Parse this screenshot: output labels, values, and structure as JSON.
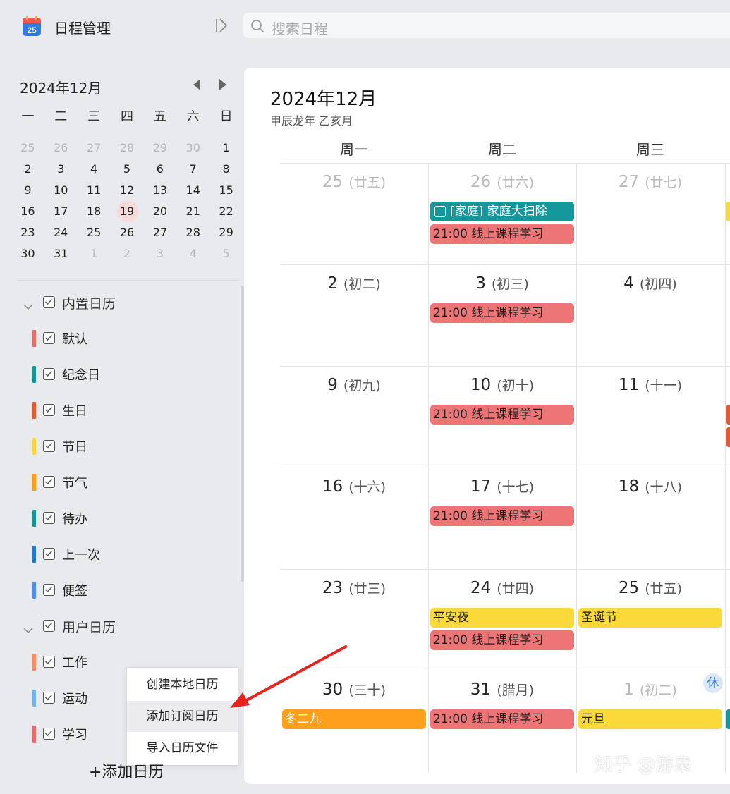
{
  "app": {
    "title": "日程管理",
    "icon_day": "25",
    "icon": "calendar-app-icon"
  },
  "search": {
    "placeholder": "搜索日程"
  },
  "mini_calendar": {
    "month_label": "2024年12月",
    "weekdays": [
      "一",
      "二",
      "三",
      "四",
      "五",
      "六",
      "日"
    ],
    "weeks": [
      [
        "25",
        "26",
        "27",
        "28",
        "29",
        "30",
        "1"
      ],
      [
        "2",
        "3",
        "4",
        "5",
        "6",
        "7",
        "8"
      ],
      [
        "9",
        "10",
        "11",
        "12",
        "13",
        "14",
        "15"
      ],
      [
        "16",
        "17",
        "18",
        "19",
        "20",
        "21",
        "22"
      ],
      [
        "23",
        "24",
        "25",
        "26",
        "27",
        "28",
        "29"
      ],
      [
        "30",
        "31",
        "1",
        "2",
        "3",
        "4",
        "5"
      ]
    ],
    "today": "19"
  },
  "calendar_groups": [
    {
      "label": "内置日历",
      "checked": true,
      "items": [
        {
          "label": "默认",
          "color": "#e76f6c",
          "checked": true
        },
        {
          "label": "纪念日",
          "color": "#13989d",
          "checked": true
        },
        {
          "label": "生日",
          "color": "#e6592c",
          "checked": true
        },
        {
          "label": "节日",
          "color": "#fcd53a",
          "checked": true
        },
        {
          "label": "节气",
          "color": "#fd9d12",
          "checked": true
        },
        {
          "label": "待办",
          "color": "#14979b",
          "checked": true
        },
        {
          "label": "上一次",
          "color": "#2378cf",
          "checked": true
        },
        {
          "label": "便签",
          "color": "#4d8ef0",
          "checked": true
        }
      ]
    },
    {
      "label": "用户日历",
      "checked": true,
      "items": [
        {
          "label": "工作",
          "color": "#f58e64",
          "checked": true
        },
        {
          "label": "运动",
          "color": "#72b3ef",
          "checked": true
        },
        {
          "label": "学习",
          "color": "#e66b6b",
          "checked": true
        }
      ]
    }
  ],
  "menu": {
    "items": [
      "创建本地日历",
      "添加订阅日历",
      "导入日历文件"
    ],
    "highlighted": "添加订阅日历"
  },
  "add_calendar_label": "+添加日历",
  "main": {
    "month_title": "2024年12月",
    "ganzhi": "甲辰龙年 乙亥月",
    "weekday_headers": [
      "周一",
      "周二",
      "周三"
    ],
    "weeks": [
      [
        {
          "day": "25",
          "lunar": "廿五",
          "muted": true,
          "events": []
        },
        {
          "day": "26",
          "lunar": "廿六",
          "muted": true,
          "events": [
            {
              "text": "[家庭] 家庭大扫除",
              "color": "teal",
              "checkbox": true
            },
            {
              "text": "21:00 线上课程学习",
              "color": "red"
            }
          ]
        },
        {
          "day": "27",
          "lunar": "廿七",
          "muted": true,
          "events": []
        }
      ],
      [
        {
          "day": "2",
          "lunar": "初二",
          "events": []
        },
        {
          "day": "3",
          "lunar": "初三",
          "events": [
            {
              "text": "21:00 线上课程学习",
              "color": "red"
            }
          ]
        },
        {
          "day": "4",
          "lunar": "初四",
          "events": []
        }
      ],
      [
        {
          "day": "9",
          "lunar": "初九",
          "events": []
        },
        {
          "day": "10",
          "lunar": "初十",
          "events": [
            {
              "text": "21:00 线上课程学习",
              "color": "red"
            }
          ]
        },
        {
          "day": "11",
          "lunar": "十一",
          "events": []
        }
      ],
      [
        {
          "day": "16",
          "lunar": "十六",
          "events": []
        },
        {
          "day": "17",
          "lunar": "十七",
          "events": [
            {
              "text": "21:00 线上课程学习",
              "color": "red"
            }
          ]
        },
        {
          "day": "18",
          "lunar": "十八",
          "events": []
        }
      ],
      [
        {
          "day": "23",
          "lunar": "廿三",
          "events": []
        },
        {
          "day": "24",
          "lunar": "廿四",
          "events": [
            {
              "text": "平安夜",
              "color": "yellow"
            },
            {
              "text": "21:00 线上课程学习",
              "color": "red"
            }
          ]
        },
        {
          "day": "25",
          "lunar": "廿五",
          "events": [
            {
              "text": "圣诞节",
              "color": "yellow"
            }
          ]
        }
      ],
      [
        {
          "day": "30",
          "lunar": "三十",
          "events": [
            {
              "text": "冬二九",
              "color": "orange"
            }
          ]
        },
        {
          "day": "31",
          "lunar": "腊月",
          "events": [
            {
              "text": "21:00 线上课程学习",
              "color": "red"
            }
          ]
        },
        {
          "day": "1",
          "lunar": "初二",
          "muted": true,
          "badge": "休",
          "events": [
            {
              "text": "元旦",
              "color": "yellow"
            }
          ]
        }
      ]
    ],
    "edge_event_colors": [
      "#fbd93b",
      "#e6592c",
      "#e6592c",
      "#13989d"
    ]
  },
  "watermark": "知乎 @游枭"
}
